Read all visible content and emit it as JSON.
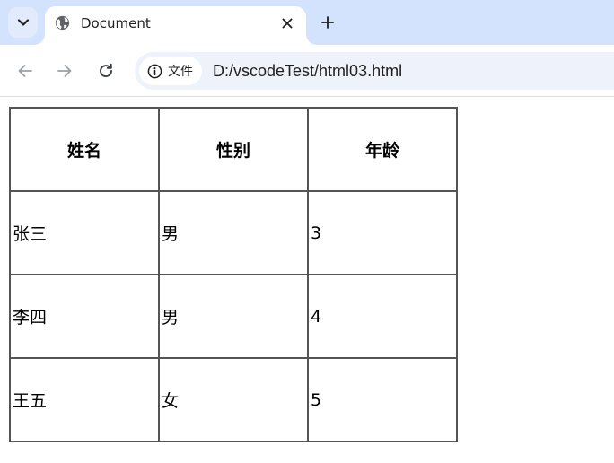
{
  "browser": {
    "tab": {
      "title": "Document",
      "favicon": "globe-icon"
    },
    "toolbar": {
      "back_icon": "back-arrow-icon",
      "forward_icon": "forward-arrow-icon",
      "reload_icon": "reload-icon",
      "site_info_label": "文件",
      "url": "D:/vscodeTest/html03.html"
    },
    "colors": {
      "tabstrip_bg": "#d3e3fd",
      "omnibox_bg": "#eef2fa",
      "table_border": "#555555"
    }
  },
  "table": {
    "headers": [
      "姓名",
      "性别",
      "年龄"
    ],
    "rows": [
      [
        "张三",
        "男",
        "3"
      ],
      [
        "李四",
        "男",
        "4"
      ],
      [
        "王五",
        "女",
        "5"
      ]
    ]
  }
}
